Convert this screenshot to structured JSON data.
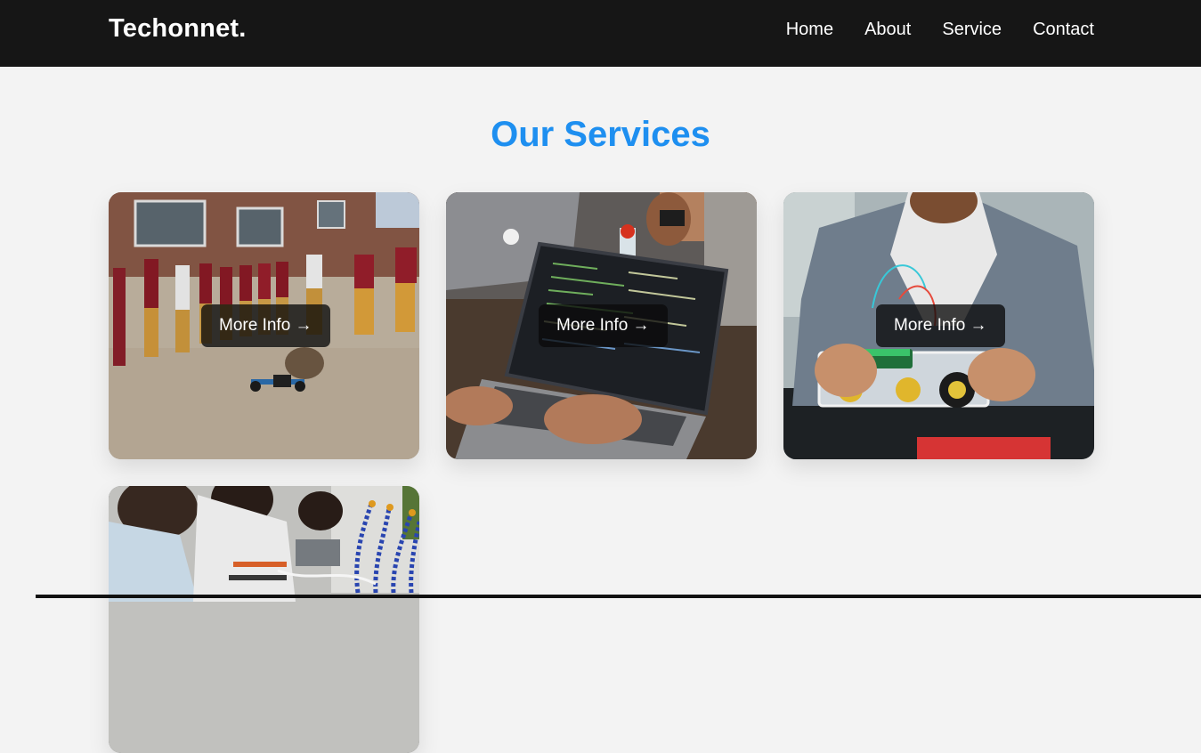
{
  "header": {
    "logo": "Techonnet.",
    "nav": [
      "Home",
      "About",
      "Service",
      "Contact"
    ]
  },
  "services": {
    "title": "Our Services",
    "cards": [
      {
        "image": "students-drone-demo-photo",
        "button_label": "More Info →"
      },
      {
        "image": "laptop-coding-photo",
        "button_label": "More Info →"
      },
      {
        "image": "child-robot-kit-photo",
        "button_label": "More Info →"
      },
      {
        "image": "students-electronics-lab-photo",
        "button_label": ""
      }
    ]
  },
  "colors": {
    "header_bg": "#161616",
    "page_bg": "#f3f3f3",
    "title_accent": "#1e8ff0",
    "button_bg": "rgba(10,10,10,0.78)"
  }
}
